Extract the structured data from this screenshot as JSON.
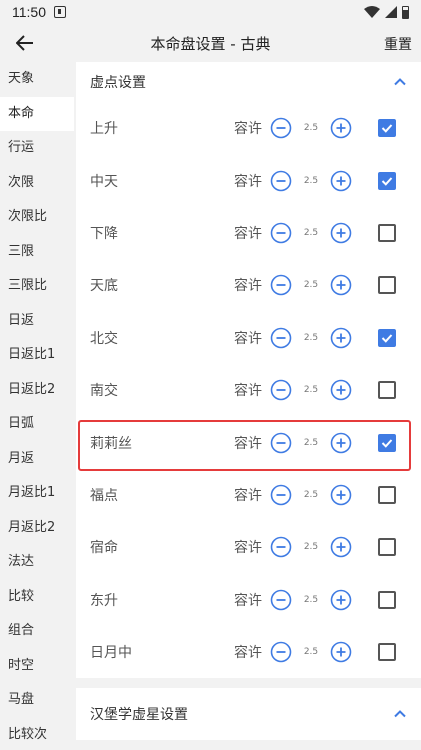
{
  "status_bar": {
    "time": "11:50"
  },
  "app_bar": {
    "title": "本命盘设置 - 古典",
    "reset_label": "重置"
  },
  "sidebar": {
    "items": [
      "天象",
      "本命",
      "行运",
      "次限",
      "次限比",
      "三限",
      "三限比",
      "日返",
      "日返比1",
      "日返比2",
      "日弧",
      "月返",
      "月返比1",
      "月返比2",
      "法达",
      "比较",
      "组合",
      "时空",
      "马盘",
      "比较次"
    ],
    "active_index": 1
  },
  "section1": {
    "title": "虚点设置",
    "rows": [
      {
        "name": "上升",
        "tolerance_label": "容许",
        "orb": "2.5",
        "checked": true
      },
      {
        "name": "中天",
        "tolerance_label": "容许",
        "orb": "2.5",
        "checked": true
      },
      {
        "name": "下降",
        "tolerance_label": "容许",
        "orb": "2.5",
        "checked": false
      },
      {
        "name": "天底",
        "tolerance_label": "容许",
        "orb": "2.5",
        "checked": false
      },
      {
        "name": "北交",
        "tolerance_label": "容许",
        "orb": "2.5",
        "checked": true
      },
      {
        "name": "南交",
        "tolerance_label": "容许",
        "orb": "2.5",
        "checked": false
      },
      {
        "name": "莉莉丝",
        "tolerance_label": "容许",
        "orb": "2.5",
        "checked": true,
        "highlighted": true
      },
      {
        "name": "福点",
        "tolerance_label": "容许",
        "orb": "2.5",
        "checked": false
      },
      {
        "name": "宿命",
        "tolerance_label": "容许",
        "orb": "2.5",
        "checked": false
      },
      {
        "name": "东升",
        "tolerance_label": "容许",
        "orb": "2.5",
        "checked": false
      },
      {
        "name": "日月中",
        "tolerance_label": "容许",
        "orb": "2.5",
        "checked": false
      }
    ]
  },
  "section2": {
    "title": "汉堡学虚星设置"
  },
  "colors": {
    "accent": "#3f7be3",
    "highlight": "#e53b3b",
    "background": "#f2f2f2"
  }
}
